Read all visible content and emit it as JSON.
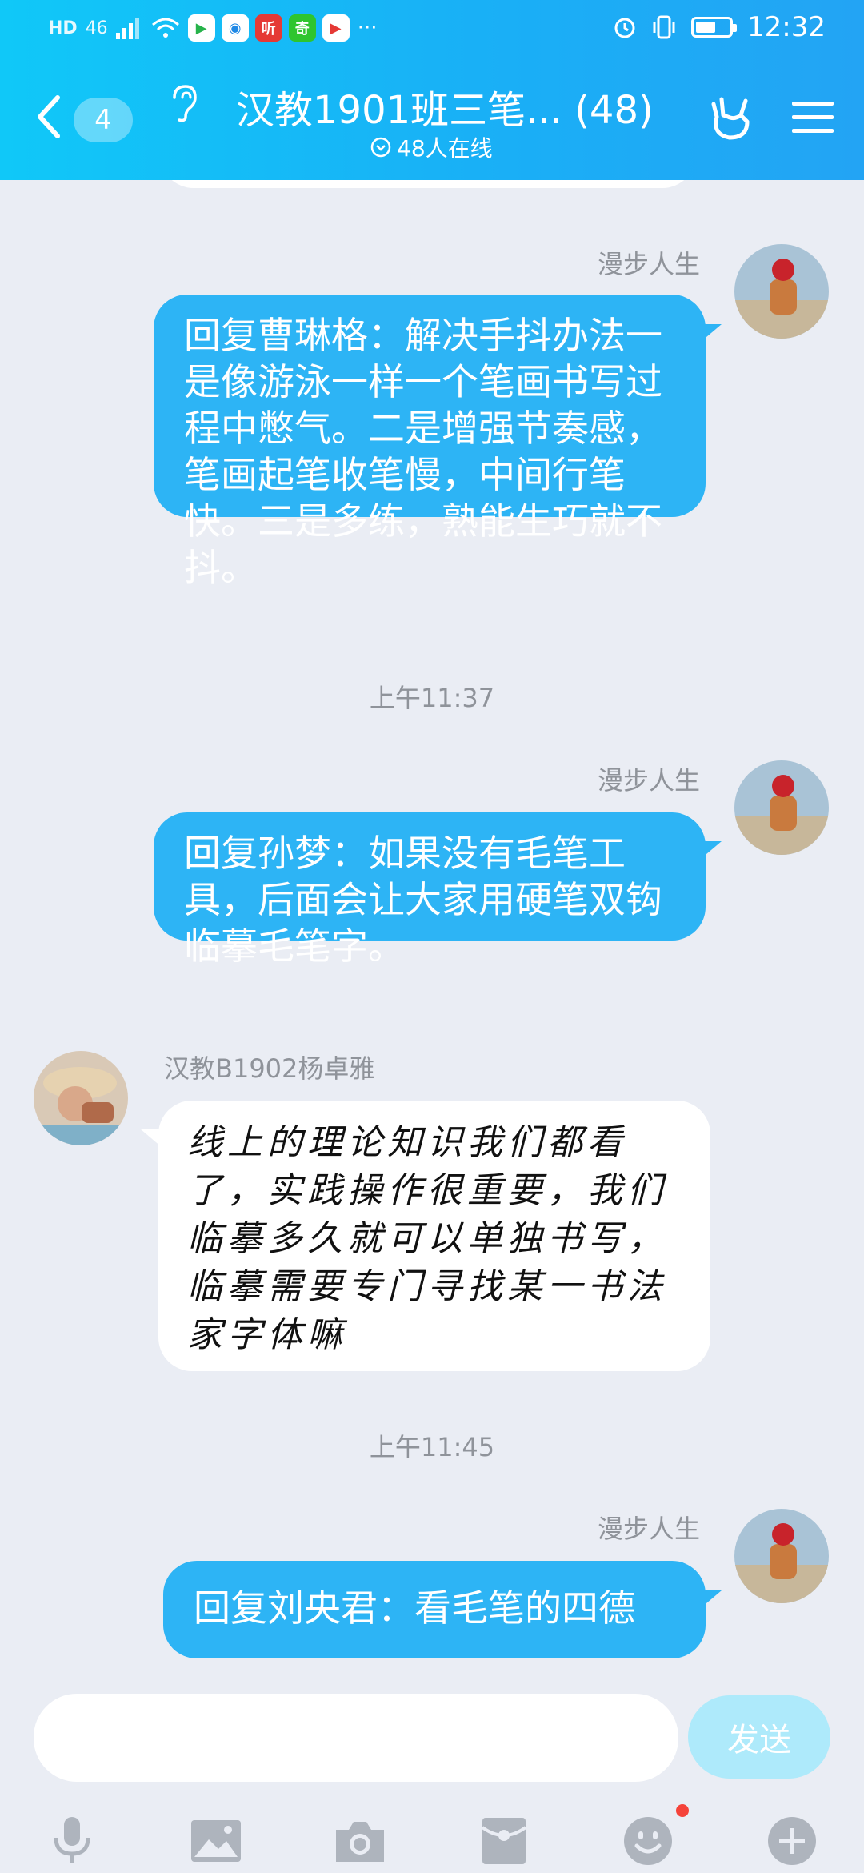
{
  "status_bar": {
    "left_hd": "HD",
    "left_signal": "46",
    "apps": [
      {
        "name": "video-app-icon",
        "glyph": "▶",
        "bg": "#ffffff",
        "fg": "#27b34b"
      },
      {
        "name": "browser-app-icon",
        "glyph": "◉",
        "bg": "#ffffff",
        "fg": "#1e88e5"
      },
      {
        "name": "listen-app-icon",
        "glyph": "听",
        "bg": "#e53935",
        "fg": "#ffffff"
      },
      {
        "name": "iqiyi-app-icon",
        "glyph": "奇",
        "bg": "#2ec52e",
        "fg": "#ffffff"
      },
      {
        "name": "video2-app-icon",
        "glyph": "▶",
        "bg": "#ffffff",
        "fg": "#e53935"
      }
    ],
    "more": "···",
    "time": "12:32",
    "battery_level": 0.6
  },
  "header": {
    "unread_count": "4",
    "title": "汉教1901班三笔... (48)",
    "online": "48人在线"
  },
  "messages": {
    "m1": {
      "sender": "漫步人生",
      "text": "回复曹琳格：解决手抖办法一是像游泳一样一个笔画书写过程中憋气。二是增强节奏感，笔画起笔收笔慢，中间行笔快。三是多练，熟能生巧就不抖。"
    },
    "t1": "上午11:37",
    "m2": {
      "sender": "漫步人生",
      "text": "回复孙梦：如果没有毛笔工具，后面会让大家用硬笔双钩临摹毛笔字。"
    },
    "m3": {
      "sender": "汉教B1902杨卓雅",
      "text": "线上的理论知识我们都看了，实践操作很重要，我们临摹多久就可以单独书写，临摹需要专门寻找某一书法家字体嘛"
    },
    "t2": "上午11:45",
    "m4": {
      "sender": "漫步人生",
      "text": "回复刘央君：看毛笔的四德"
    }
  },
  "input": {
    "placeholder": "",
    "send_label": "发送"
  },
  "colors": {
    "header_start": "#10c8f8",
    "bubble_blue": "#2db4f5",
    "background": "#eaedf4",
    "send_disabled": "#aeeafb"
  }
}
